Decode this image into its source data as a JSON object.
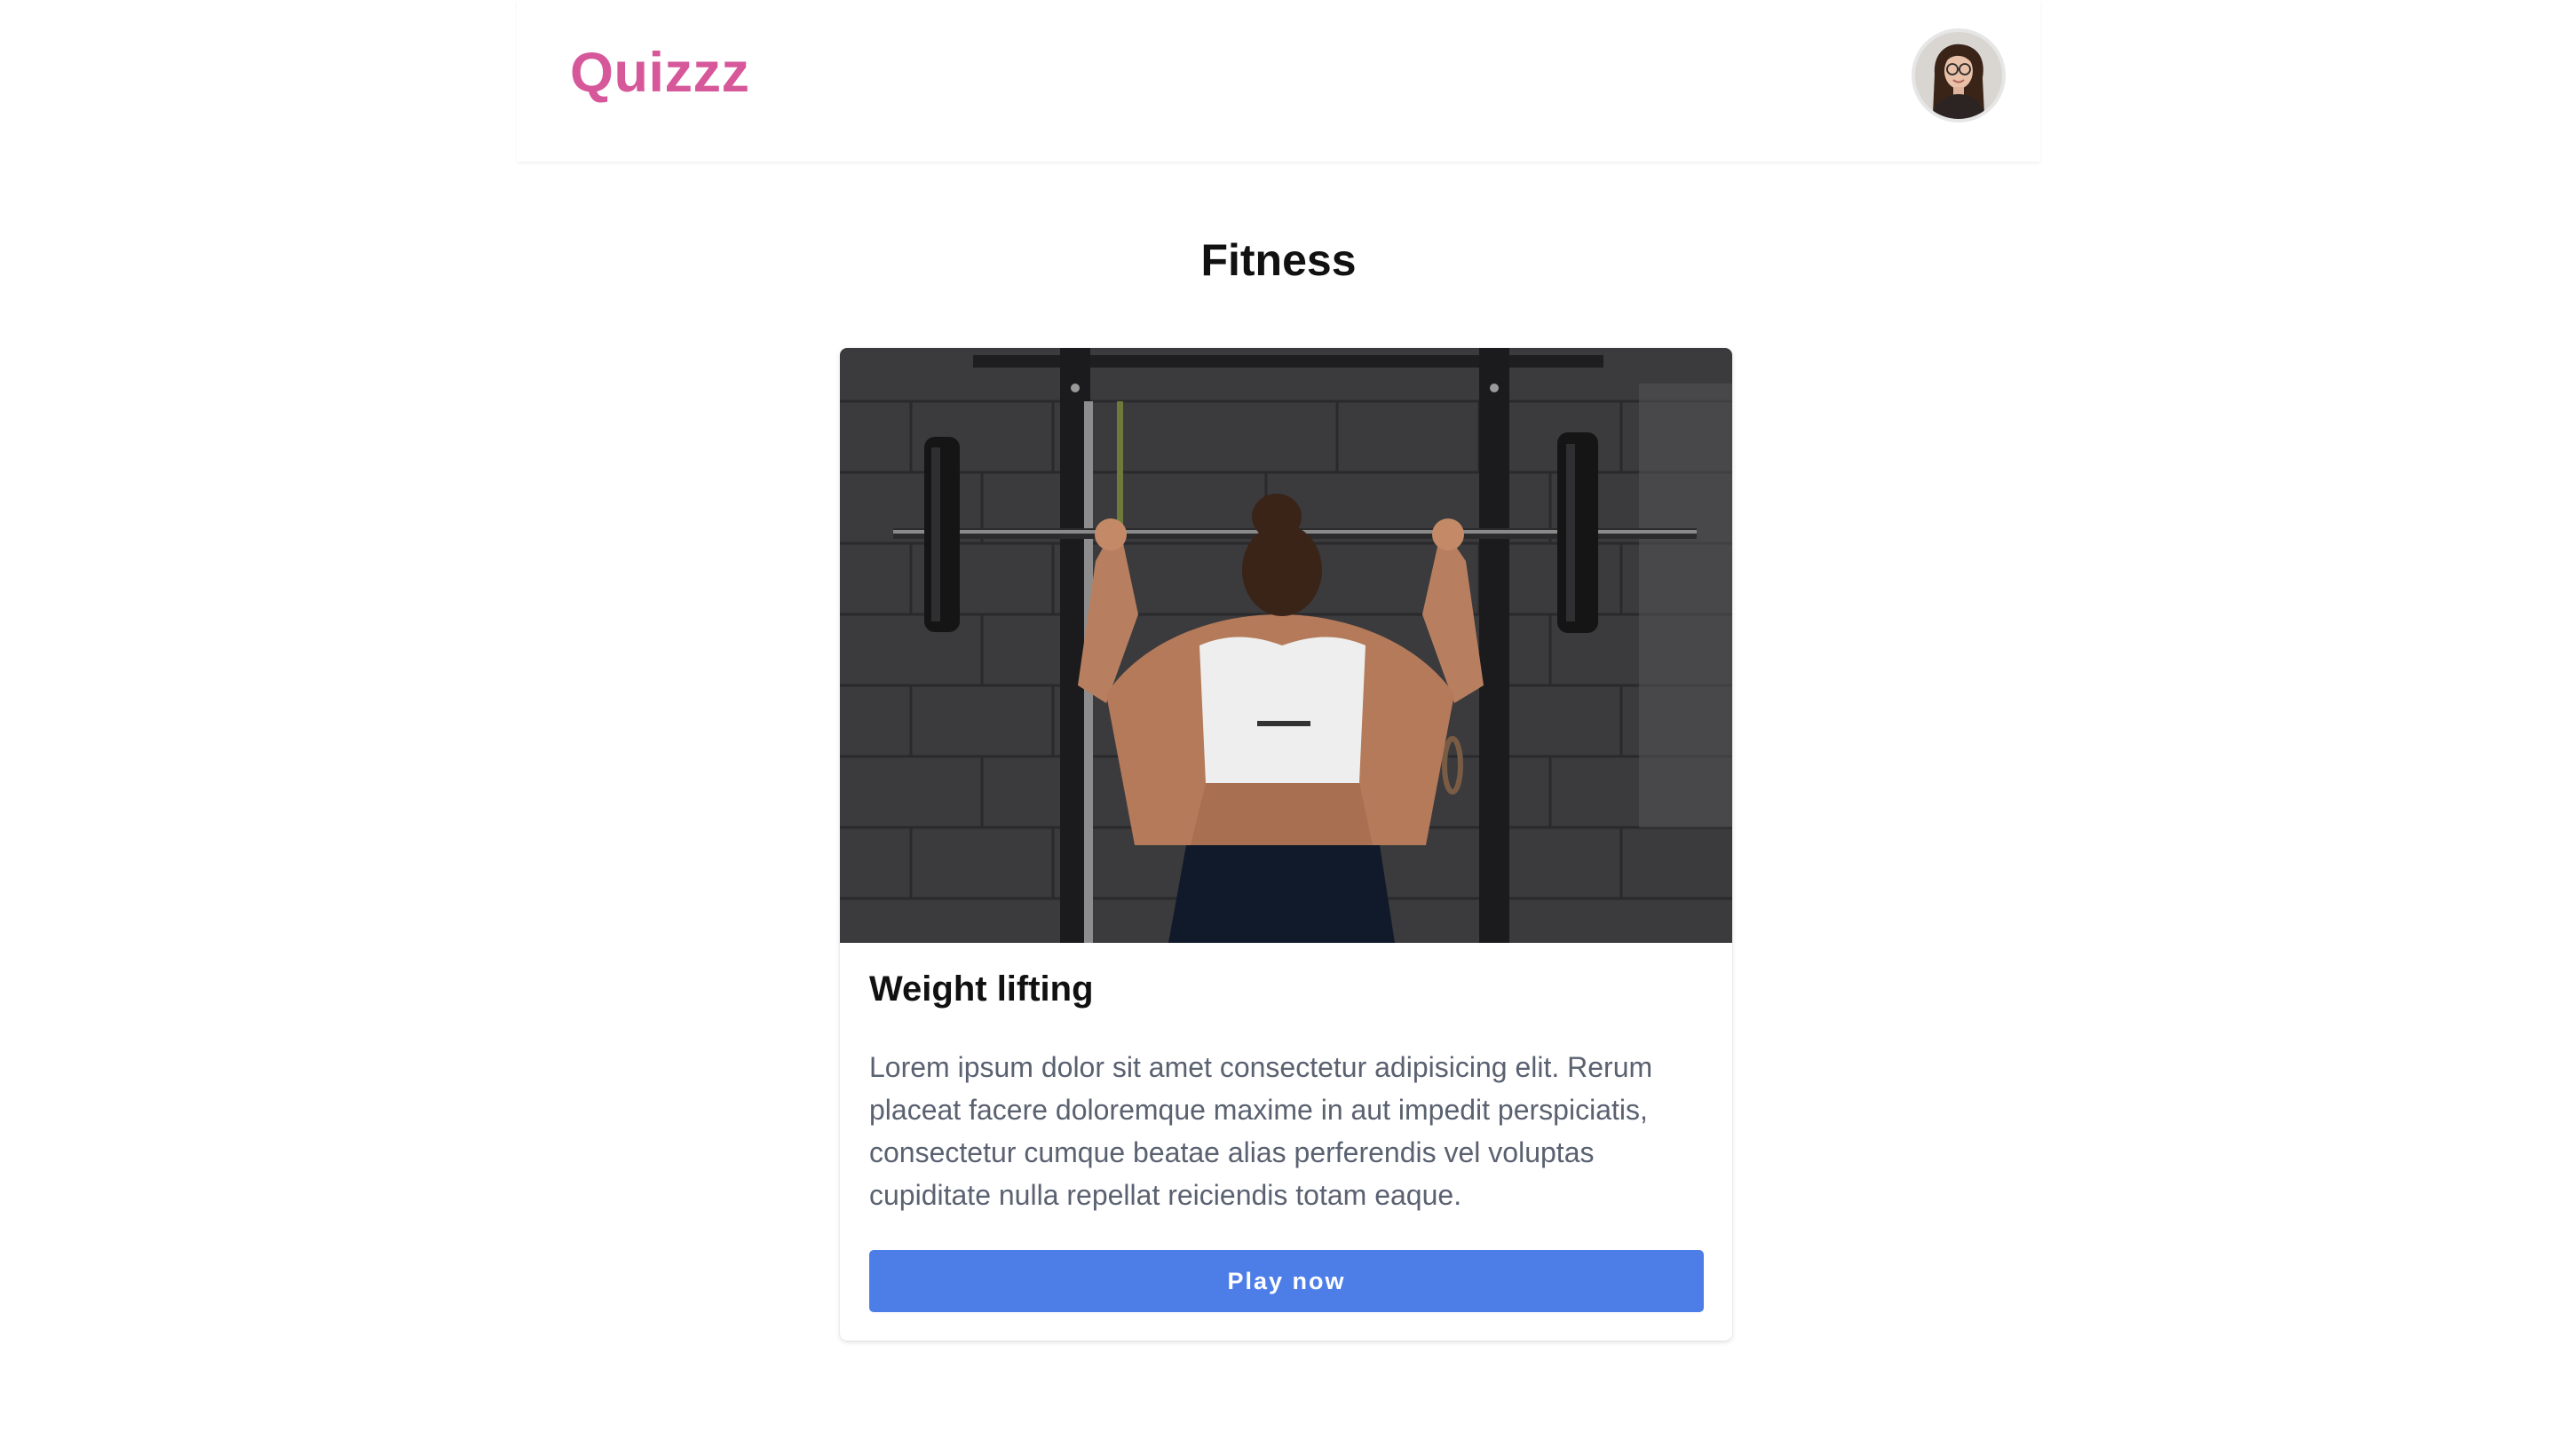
{
  "header": {
    "logo_text": "Quizzz"
  },
  "page": {
    "title": "Fitness"
  },
  "card": {
    "title": "Weight lifting",
    "description": "Lorem ipsum dolor sit amet consectetur adipisicing elit. Rerum placeat facere doloremque maxime in aut impedit perspiciatis, consectetur cumque beatae alias perferendis vel voluptas cupiditate nulla repellat reiciendis totam eaque.",
    "button_label": "Play now"
  },
  "colors": {
    "brand": "#d6589a",
    "button": "#4d7ee8",
    "description_text": "#5a6170"
  }
}
